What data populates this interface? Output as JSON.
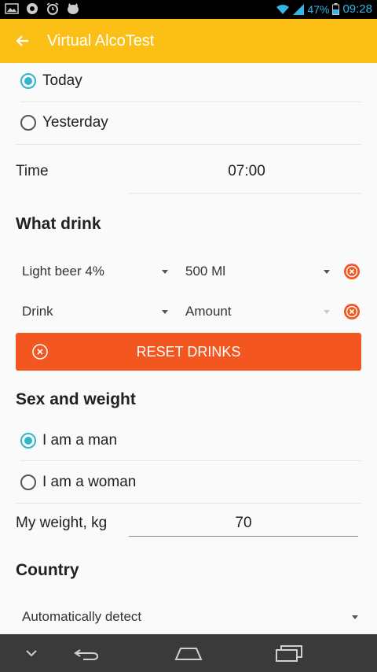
{
  "status_bar": {
    "battery": "47%",
    "time": "09:28"
  },
  "app_bar": {
    "title": "Virtual AlcoTest"
  },
  "day": {
    "options": [
      {
        "label": "Today",
        "selected": true
      },
      {
        "label": "Yesterday",
        "selected": false
      }
    ]
  },
  "time": {
    "label": "Time",
    "value": "07:00"
  },
  "drinks": {
    "title": "What drink",
    "rows": [
      {
        "drink": "Light beer 4%",
        "amount": "500 Ml"
      },
      {
        "drink": "Drink",
        "amount": "Amount"
      }
    ],
    "reset_label": "RESET DRINKS"
  },
  "sex_weight": {
    "title": "Sex and weight",
    "options": [
      {
        "label": "I am a man",
        "selected": true
      },
      {
        "label": "I am a woman",
        "selected": false
      }
    ],
    "weight_label": "My weight, kg",
    "weight_value": "70"
  },
  "country": {
    "title": "Country",
    "selected": "Automatically detect"
  },
  "colors": {
    "accent": "#33b5c9",
    "app_bar": "#fbbf16",
    "reset": "#f4561f"
  }
}
